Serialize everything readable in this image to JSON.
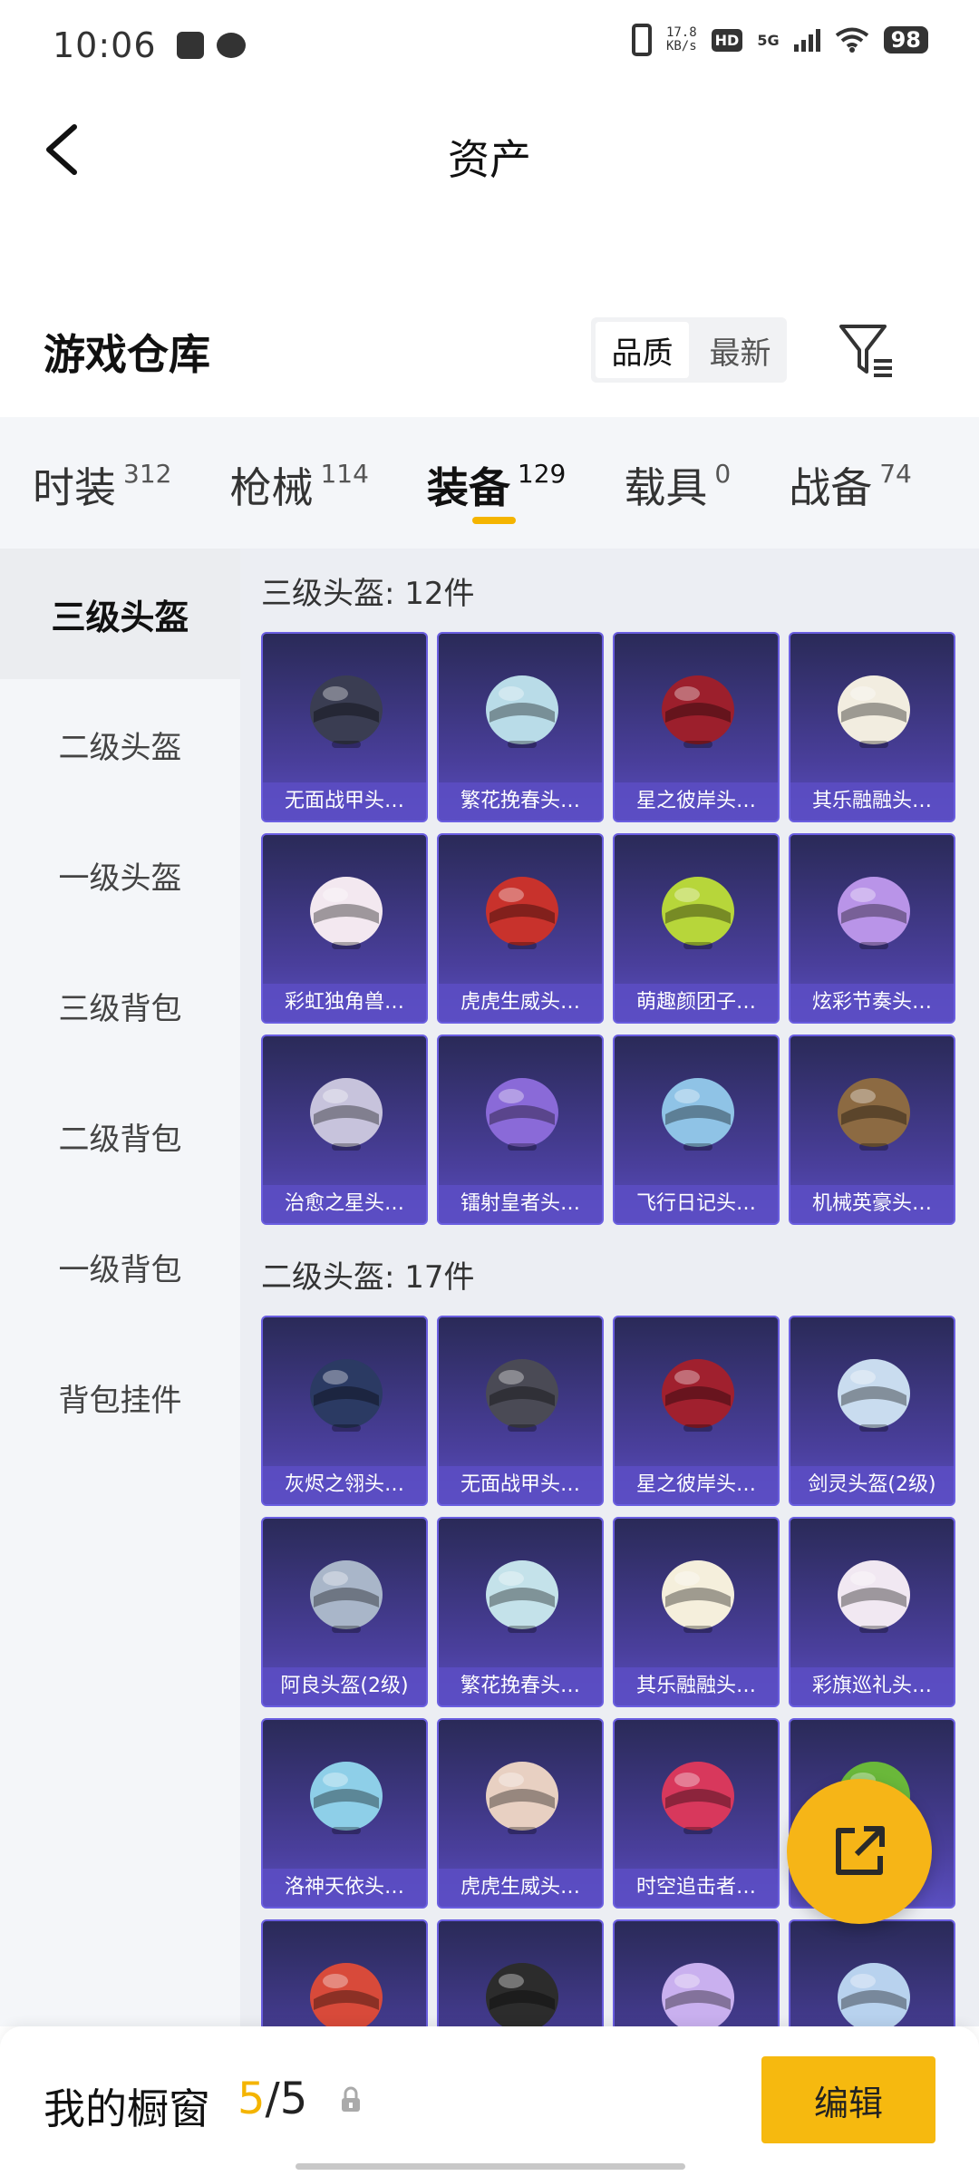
{
  "status_bar": {
    "time": "10:06",
    "net_speed_value": "17.8",
    "net_speed_unit": "KB/s",
    "hd_badge": "HD",
    "network": "5G",
    "battery": "98"
  },
  "header": {
    "title": "资产",
    "back_icon": "chevron-left-icon"
  },
  "warehouse": {
    "title": "游戏仓库",
    "sort_options": [
      "品质",
      "最新"
    ],
    "sort_selected": "品质",
    "filter_icon": "filter-icon"
  },
  "category_tabs": [
    {
      "label": "时装",
      "count": "312"
    },
    {
      "label": "枪械",
      "count": "114"
    },
    {
      "label": "装备",
      "count": "129"
    },
    {
      "label": "载具",
      "count": "0"
    },
    {
      "label": "战备",
      "count": "74"
    }
  ],
  "active_category": "装备",
  "sidebar": [
    {
      "label": "三级头盔"
    },
    {
      "label": "二级头盔"
    },
    {
      "label": "一级头盔"
    },
    {
      "label": "三级背包"
    },
    {
      "label": "二级背包"
    },
    {
      "label": "一级背包"
    },
    {
      "label": "背包挂件"
    }
  ],
  "active_sidebar": "三级头盔",
  "sections": [
    {
      "title": "三级头盔: 12件",
      "items": [
        {
          "name": "无面战甲头…",
          "color": "#3a3d52"
        },
        {
          "name": "繁花挽春头…",
          "color": "#b9dce8"
        },
        {
          "name": "星之彼岸头…",
          "color": "#9c1f2c"
        },
        {
          "name": "其乐融融头…",
          "color": "#f2ede0"
        },
        {
          "name": "彩虹独角兽…",
          "color": "#f3e8f0"
        },
        {
          "name": "虎虎生威头…",
          "color": "#c8322c"
        },
        {
          "name": "萌趣颜团子…",
          "color": "#b7d63a"
        },
        {
          "name": "炫彩节奏头…",
          "color": "#b994e8"
        },
        {
          "name": "治愈之星头…",
          "color": "#c7c3dc"
        },
        {
          "name": "镭射皇者头…",
          "color": "#8a6ad8"
        },
        {
          "name": "飞行日记头…",
          "color": "#8fc3e6"
        },
        {
          "name": "机械英豪头…",
          "color": "#8c6a42"
        }
      ]
    },
    {
      "title": "二级头盔: 17件",
      "items": [
        {
          "name": "灰烬之翎头…",
          "color": "#2b3a63"
        },
        {
          "name": "无面战甲头…",
          "color": "#4a4a55"
        },
        {
          "name": "星之彼岸头…",
          "color": "#a0202e"
        },
        {
          "name": "剑灵头盔(2级)",
          "color": "#c9dcef"
        },
        {
          "name": "阿良头盔(2级)",
          "color": "#a9b6c9"
        },
        {
          "name": "繁花挽春头…",
          "color": "#c4e2ea"
        },
        {
          "name": "其乐融融头…",
          "color": "#f5efdc"
        },
        {
          "name": "彩旗巡礼头…",
          "color": "#f1e8f2"
        },
        {
          "name": "洛神天依头…",
          "color": "#8ecfe8"
        },
        {
          "name": "虎虎生威头…",
          "color": "#e8d0c2"
        },
        {
          "name": "时空追击者…",
          "color": "#d8385c"
        },
        {
          "name": "",
          "color": "#6ab83a"
        },
        {
          "name": "",
          "color": "#d84a3a"
        },
        {
          "name": "",
          "color": "#2c2c2c"
        },
        {
          "name": "",
          "color": "#c9b0ef"
        },
        {
          "name": "",
          "color": "#b8d2ee"
        }
      ]
    }
  ],
  "fab": {
    "icon": "share-external-icon",
    "color": "#f6b517"
  },
  "bottom_bar": {
    "label": "我的橱窗",
    "current": "5",
    "separator": "/",
    "total": "5",
    "lock_icon": "lock-icon",
    "edit_label": "编辑"
  },
  "colors": {
    "accent": "#f4b400",
    "card_bg": "#3d3585",
    "card_label_bg": "#5c4ec4"
  }
}
